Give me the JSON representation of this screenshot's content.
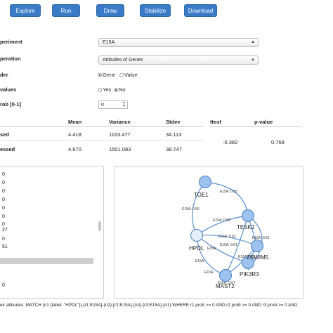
{
  "toolbar": {
    "explore": "Explore",
    "run": "Run",
    "draw": "Draw",
    "stabilize": "Stabilize",
    "download": "Download"
  },
  "form": {
    "experiment_label": "periment",
    "experiment_value": "E15A",
    "operation_label": "peration",
    "operation_value": "Attitudes of Genes",
    "order_label": "der",
    "order_gene": "Gene",
    "order_value": "Value",
    "values_label": " values",
    "values_yes": "Yes",
    "values_no": "No",
    "prob_label": "rob [0-1]",
    "prob_value": "0"
  },
  "stats": {
    "headers": [
      "Mean",
      "Variance",
      "Stdev",
      "ttest",
      "p-value"
    ],
    "rows": [
      {
        "label": "sed",
        "mean": "4.418",
        "variance": "1163.477",
        "stdev": "34.113"
      },
      {
        "label": "essed",
        "mean": "4.670",
        "variance": "1501.083",
        "stdev": "38.747"
      }
    ],
    "ttest": "-0.382",
    "pvalue": "0.768"
  },
  "left_list": [
    "0",
    "0",
    "0",
    "0",
    "0",
    "0",
    "0",
    "27",
    "0",
    "51",
    "",
    "",
    "",
    "",
    "0"
  ],
  "graph": {
    "nodes": [
      {
        "id": "TOE1",
        "label": "TOE1"
      },
      {
        "id": "TESK2",
        "label": "TESK2"
      },
      {
        "id": "HPDL",
        "label": "HPDL"
      },
      {
        "id": "ZSWIM5",
        "label": "ZSWIM5"
      },
      {
        "id": "PIK3R3",
        "label": "PIK3R3"
      },
      {
        "id": "MAST2",
        "label": "MAST2"
      }
    ],
    "edge_labels": [
      "E15A: 0.55",
      "E15A: 0.55",
      "E15A: 0.61",
      "E15A: 0.55",
      "E15A: 0.61",
      "E15A: 0.61",
      "E15A:",
      "E15A: 0.61",
      "E15A:",
      "E15A:",
      "E15A: 0.67"
    ]
  },
  "query": "eir attitudes: MATCH (n1 {label: \"HPDL\"})-[r1:E15A]-(n2)-[r2:E15A]-(n3)-[r3:E15A]-(n1) WHERE r1.prob >= 0 AND r2.prob >= 0 AND r3.prob >= 0 AND"
}
